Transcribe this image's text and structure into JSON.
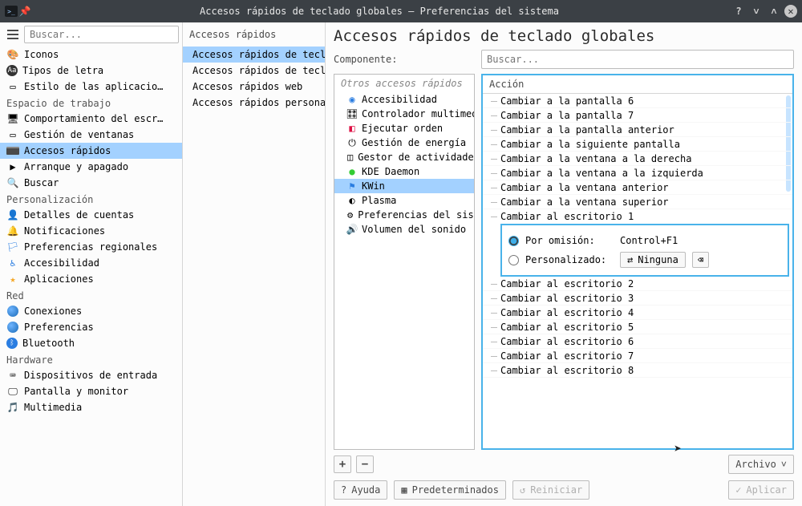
{
  "window": {
    "title": "Accesos rápidos de teclado globales — Preferencias del sistema"
  },
  "nav": {
    "search_placeholder": "Buscar...",
    "items": [
      {
        "label": "Iconos"
      },
      {
        "label": "Tipos de letra"
      },
      {
        "label": "Estilo de las aplicacio…"
      }
    ],
    "cat_workspace": "Espacio de trabajo",
    "workspace": [
      {
        "label": "Comportamiento del escr…"
      },
      {
        "label": "Gestión de ventanas"
      },
      {
        "label": "Accesos rápidos",
        "active": true
      },
      {
        "label": "Arranque y apagado"
      },
      {
        "label": "Buscar"
      }
    ],
    "cat_personalization": "Personalización",
    "personalization": [
      {
        "label": "Detalles de cuentas"
      },
      {
        "label": "Notificaciones"
      },
      {
        "label": "Preferencias regionales"
      },
      {
        "label": "Accesibilidad"
      },
      {
        "label": "Aplicaciones"
      }
    ],
    "cat_network": "Red",
    "network": [
      {
        "label": "Conexiones"
      },
      {
        "label": "Preferencias"
      },
      {
        "label": "Bluetooth"
      }
    ],
    "cat_hardware": "Hardware",
    "hardware": [
      {
        "label": "Dispositivos de entrada"
      },
      {
        "label": "Pantalla y monitor"
      },
      {
        "label": "Multimedia"
      }
    ]
  },
  "shortcuts": {
    "header": "Accesos rápidos",
    "items": [
      {
        "label": "Accesos rápidos de teclad…",
        "active": true
      },
      {
        "label": "Accesos rápidos de teclad…"
      },
      {
        "label": "Accesos rápidos web"
      },
      {
        "label": "Accesos rápidos personali…"
      }
    ]
  },
  "main": {
    "heading": "Accesos rápidos de teclado globales",
    "component_label": "Componente:",
    "search_placeholder": "Buscar...",
    "components_header": "Otros accesos rápidos",
    "components": [
      {
        "label": "Accesibilidad",
        "icon": "a11y"
      },
      {
        "label": "Controlador multimedia",
        "icon": "media"
      },
      {
        "label": "Ejecutar orden",
        "icon": "run"
      },
      {
        "label": "Gestión de energía",
        "icon": "power"
      },
      {
        "label": "Gestor de actividades",
        "icon": "activities"
      },
      {
        "label": "KDE Daemon",
        "icon": "daemon"
      },
      {
        "label": "KWin",
        "icon": "kwin",
        "active": true
      },
      {
        "label": "Plasma",
        "icon": "plasma"
      },
      {
        "label": "Preferencias del sistema",
        "icon": "settings"
      },
      {
        "label": "Volumen del sonido",
        "icon": "volume"
      }
    ],
    "actions_header": "Acción",
    "actions_pre": [
      "Cambiar a la pantalla 6",
      "Cambiar a la pantalla 7",
      "Cambiar a la pantalla anterior",
      "Cambiar a la siguiente pantalla",
      "Cambiar a la ventana a la derecha",
      "Cambiar a la ventana a la izquierda",
      "Cambiar a la ventana anterior",
      "Cambiar a la ventana superior"
    ],
    "selected_action": "Cambiar al escritorio 1",
    "editor": {
      "default_label": "Por omisión:",
      "default_value": "Control+F1",
      "custom_label": "Personalizado:",
      "none_label": "Ninguna"
    },
    "actions_post": [
      "Cambiar al escritorio 2",
      "Cambiar al escritorio 3",
      "Cambiar al escritorio 4",
      "Cambiar al escritorio 5",
      "Cambiar al escritorio 6",
      "Cambiar al escritorio 7",
      "Cambiar al escritorio 8"
    ],
    "file_button": "Archivo",
    "help": "Ayuda",
    "defaults": "Predeterminados",
    "restart": "Reiniciar",
    "apply": "Aplicar"
  }
}
